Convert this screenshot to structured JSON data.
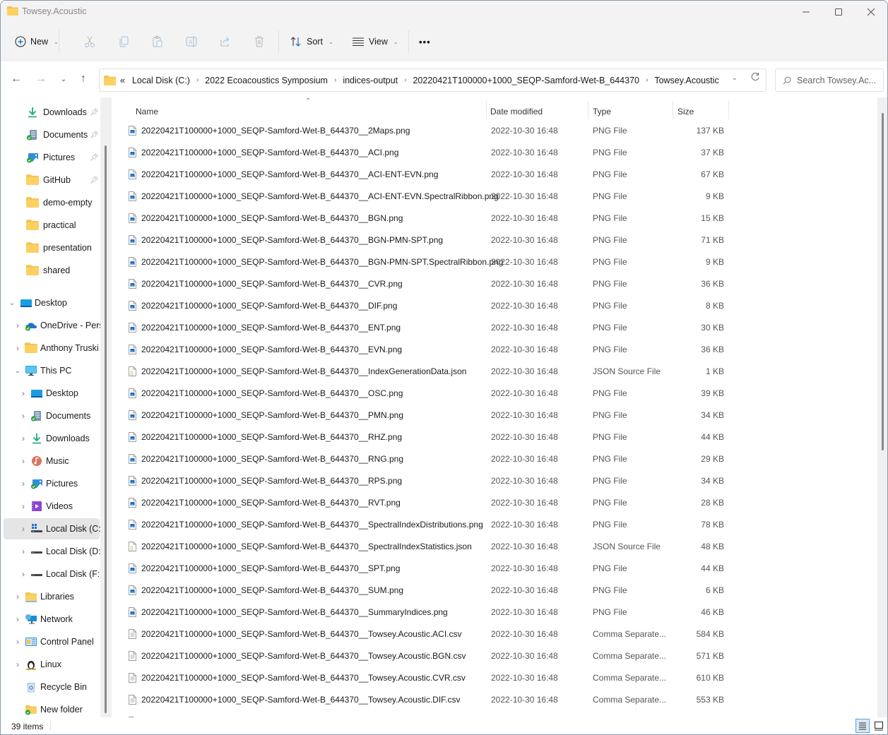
{
  "window": {
    "title": "Towsey.Acoustic",
    "controls": {
      "minimize": "minimize",
      "maximize": "maximize",
      "close": "close"
    }
  },
  "toolbar": {
    "new_label": "New",
    "sort_label": "Sort",
    "view_label": "View",
    "more_label": "•••",
    "icons": [
      "plus-circle-icon",
      "cut-icon",
      "copy-icon",
      "paste-icon",
      "rename-icon",
      "share-icon",
      "delete-icon",
      "sort-icon",
      "view-icon",
      "more-icon"
    ]
  },
  "address": {
    "overflow": "«",
    "breadcrumbs": [
      "Local Disk (C:)",
      "2022 Ecoacoustics Symposium",
      "indices-output",
      "20220421T100000+1000_SEQP-Samford-Wet-B_644370",
      "Towsey.Acoustic"
    ],
    "search_placeholder": "Search Towsey.Ac..."
  },
  "sidebar": {
    "quick_access": [
      {
        "label": "Downloads",
        "icon": "downloads-icon",
        "pinned": true
      },
      {
        "label": "Documents",
        "icon": "documents-icon",
        "pinned": true
      },
      {
        "label": "Pictures",
        "icon": "pictures-icon",
        "pinned": true
      },
      {
        "label": "GitHub",
        "icon": "folder-icon",
        "pinned": true
      },
      {
        "label": "demo-empty",
        "icon": "folder-icon",
        "pinned": false
      },
      {
        "label": "practical",
        "icon": "folder-icon",
        "pinned": false
      },
      {
        "label": "presentation",
        "icon": "folder-icon",
        "pinned": false
      },
      {
        "label": "shared",
        "icon": "folder-icon",
        "pinned": false
      }
    ],
    "tree": [
      {
        "label": "Desktop",
        "icon": "desktop-icon",
        "level": 0,
        "expander": "expanded"
      },
      {
        "label": "OneDrive - Pers",
        "icon": "onedrive-icon",
        "level": 1,
        "expander": "collapsed"
      },
      {
        "label": "Anthony Truski",
        "icon": "folder-icon",
        "level": 1,
        "expander": "collapsed"
      },
      {
        "label": "This PC",
        "icon": "this-pc-icon",
        "level": 1,
        "expander": "expanded"
      },
      {
        "label": "Desktop",
        "icon": "desktop-icon",
        "level": 2,
        "expander": "collapsed"
      },
      {
        "label": "Documents",
        "icon": "documents-icon",
        "level": 2,
        "expander": "collapsed"
      },
      {
        "label": "Downloads",
        "icon": "downloads-icon",
        "level": 2,
        "expander": "collapsed"
      },
      {
        "label": "Music",
        "icon": "music-icon",
        "level": 2,
        "expander": "collapsed"
      },
      {
        "label": "Pictures",
        "icon": "pictures-icon",
        "level": 2,
        "expander": "collapsed"
      },
      {
        "label": "Videos",
        "icon": "videos-icon",
        "level": 2,
        "expander": "collapsed"
      },
      {
        "label": "Local Disk (C:)",
        "icon": "windows-drive-icon",
        "level": 2,
        "expander": "collapsed",
        "selected": true
      },
      {
        "label": "Local Disk (D:)",
        "icon": "drive-icon",
        "level": 2,
        "expander": "collapsed"
      },
      {
        "label": "Local Disk (F:)",
        "icon": "drive-icon",
        "level": 2,
        "expander": "collapsed"
      },
      {
        "label": "Libraries",
        "icon": "libraries-icon",
        "level": 1,
        "expander": "collapsed"
      },
      {
        "label": "Network",
        "icon": "network-icon",
        "level": 1,
        "expander": "collapsed"
      },
      {
        "label": "Control Panel",
        "icon": "control-panel-icon",
        "level": 1,
        "expander": "collapsed"
      },
      {
        "label": "Linux",
        "icon": "linux-icon",
        "level": 1,
        "expander": "collapsed"
      },
      {
        "label": "Recycle Bin",
        "icon": "recycle-bin-icon",
        "level": 1,
        "expander": "none"
      },
      {
        "label": "New folder",
        "icon": "synced-folder-icon",
        "level": 1,
        "expander": "none"
      }
    ]
  },
  "columns": {
    "name": "Name",
    "date": "Date modified",
    "type": "Type",
    "size": "Size"
  },
  "files": [
    {
      "name": "20220421T100000+1000_SEQP-Samford-Wet-B_644370__2Maps.png",
      "date": "2022-10-30 16:48",
      "type": "PNG File",
      "size": "137 KB",
      "kind": "png"
    },
    {
      "name": "20220421T100000+1000_SEQP-Samford-Wet-B_644370__ACI.png",
      "date": "2022-10-30 16:48",
      "type": "PNG File",
      "size": "37 KB",
      "kind": "png"
    },
    {
      "name": "20220421T100000+1000_SEQP-Samford-Wet-B_644370__ACI-ENT-EVN.png",
      "date": "2022-10-30 16:48",
      "type": "PNG File",
      "size": "67 KB",
      "kind": "png"
    },
    {
      "name": "20220421T100000+1000_SEQP-Samford-Wet-B_644370__ACI-ENT-EVN.SpectralRibbon.png",
      "date": "2022-10-30 16:48",
      "type": "PNG File",
      "size": "9 KB",
      "kind": "png"
    },
    {
      "name": "20220421T100000+1000_SEQP-Samford-Wet-B_644370__BGN.png",
      "date": "2022-10-30 16:48",
      "type": "PNG File",
      "size": "15 KB",
      "kind": "png"
    },
    {
      "name": "20220421T100000+1000_SEQP-Samford-Wet-B_644370__BGN-PMN-SPT.png",
      "date": "2022-10-30 16:48",
      "type": "PNG File",
      "size": "71 KB",
      "kind": "png"
    },
    {
      "name": "20220421T100000+1000_SEQP-Samford-Wet-B_644370__BGN-PMN-SPT.SpectralRibbon.png",
      "date": "2022-10-30 16:48",
      "type": "PNG File",
      "size": "9 KB",
      "kind": "png"
    },
    {
      "name": "20220421T100000+1000_SEQP-Samford-Wet-B_644370__CVR.png",
      "date": "2022-10-30 16:48",
      "type": "PNG File",
      "size": "36 KB",
      "kind": "png"
    },
    {
      "name": "20220421T100000+1000_SEQP-Samford-Wet-B_644370__DIF.png",
      "date": "2022-10-30 16:48",
      "type": "PNG File",
      "size": "8 KB",
      "kind": "png"
    },
    {
      "name": "20220421T100000+1000_SEQP-Samford-Wet-B_644370__ENT.png",
      "date": "2022-10-30 16:48",
      "type": "PNG File",
      "size": "30 KB",
      "kind": "png"
    },
    {
      "name": "20220421T100000+1000_SEQP-Samford-Wet-B_644370__EVN.png",
      "date": "2022-10-30 16:48",
      "type": "PNG File",
      "size": "36 KB",
      "kind": "png"
    },
    {
      "name": "20220421T100000+1000_SEQP-Samford-Wet-B_644370__IndexGenerationData.json",
      "date": "2022-10-30 16:48",
      "type": "JSON Source File",
      "size": "1 KB",
      "kind": "json"
    },
    {
      "name": "20220421T100000+1000_SEQP-Samford-Wet-B_644370__OSC.png",
      "date": "2022-10-30 16:48",
      "type": "PNG File",
      "size": "39 KB",
      "kind": "png"
    },
    {
      "name": "20220421T100000+1000_SEQP-Samford-Wet-B_644370__PMN.png",
      "date": "2022-10-30 16:48",
      "type": "PNG File",
      "size": "34 KB",
      "kind": "png"
    },
    {
      "name": "20220421T100000+1000_SEQP-Samford-Wet-B_644370__RHZ.png",
      "date": "2022-10-30 16:48",
      "type": "PNG File",
      "size": "44 KB",
      "kind": "png"
    },
    {
      "name": "20220421T100000+1000_SEQP-Samford-Wet-B_644370__RNG.png",
      "date": "2022-10-30 16:48",
      "type": "PNG File",
      "size": "29 KB",
      "kind": "png"
    },
    {
      "name": "20220421T100000+1000_SEQP-Samford-Wet-B_644370__RPS.png",
      "date": "2022-10-30 16:48",
      "type": "PNG File",
      "size": "34 KB",
      "kind": "png"
    },
    {
      "name": "20220421T100000+1000_SEQP-Samford-Wet-B_644370__RVT.png",
      "date": "2022-10-30 16:48",
      "type": "PNG File",
      "size": "28 KB",
      "kind": "png"
    },
    {
      "name": "20220421T100000+1000_SEQP-Samford-Wet-B_644370__SpectralIndexDistributions.png",
      "date": "2022-10-30 16:48",
      "type": "PNG File",
      "size": "78 KB",
      "kind": "png"
    },
    {
      "name": "20220421T100000+1000_SEQP-Samford-Wet-B_644370__SpectralIndexStatistics.json",
      "date": "2022-10-30 16:48",
      "type": "JSON Source File",
      "size": "48 KB",
      "kind": "json"
    },
    {
      "name": "20220421T100000+1000_SEQP-Samford-Wet-B_644370__SPT.png",
      "date": "2022-10-30 16:48",
      "type": "PNG File",
      "size": "44 KB",
      "kind": "png"
    },
    {
      "name": "20220421T100000+1000_SEQP-Samford-Wet-B_644370__SUM.png",
      "date": "2022-10-30 16:48",
      "type": "PNG File",
      "size": "6 KB",
      "kind": "png"
    },
    {
      "name": "20220421T100000+1000_SEQP-Samford-Wet-B_644370__SummaryIndices.png",
      "date": "2022-10-30 16:48",
      "type": "PNG File",
      "size": "46 KB",
      "kind": "png"
    },
    {
      "name": "20220421T100000+1000_SEQP-Samford-Wet-B_644370__Towsey.Acoustic.ACI.csv",
      "date": "2022-10-30 16:48",
      "type": "Comma Separate...",
      "size": "584 KB",
      "kind": "csv"
    },
    {
      "name": "20220421T100000+1000_SEQP-Samford-Wet-B_644370__Towsey.Acoustic.BGN.csv",
      "date": "2022-10-30 16:48",
      "type": "Comma Separate...",
      "size": "571 KB",
      "kind": "csv"
    },
    {
      "name": "20220421T100000+1000_SEQP-Samford-Wet-B_644370__Towsey.Acoustic.CVR.csv",
      "date": "2022-10-30 16:48",
      "type": "Comma Separate...",
      "size": "610 KB",
      "kind": "csv"
    },
    {
      "name": "20220421T100000+1000_SEQP-Samford-Wet-B_644370__Towsey.Acoustic.DIF.csv",
      "date": "2022-10-30 16:48",
      "type": "Comma Separate...",
      "size": "553 KB",
      "kind": "csv"
    }
  ],
  "status": {
    "item_count": "39 items"
  },
  "colors": {
    "accent": "#0067c0",
    "folder": "#f3c34b",
    "selected_bg": "#e5e5e5",
    "details_active": "#dbe9f6"
  }
}
